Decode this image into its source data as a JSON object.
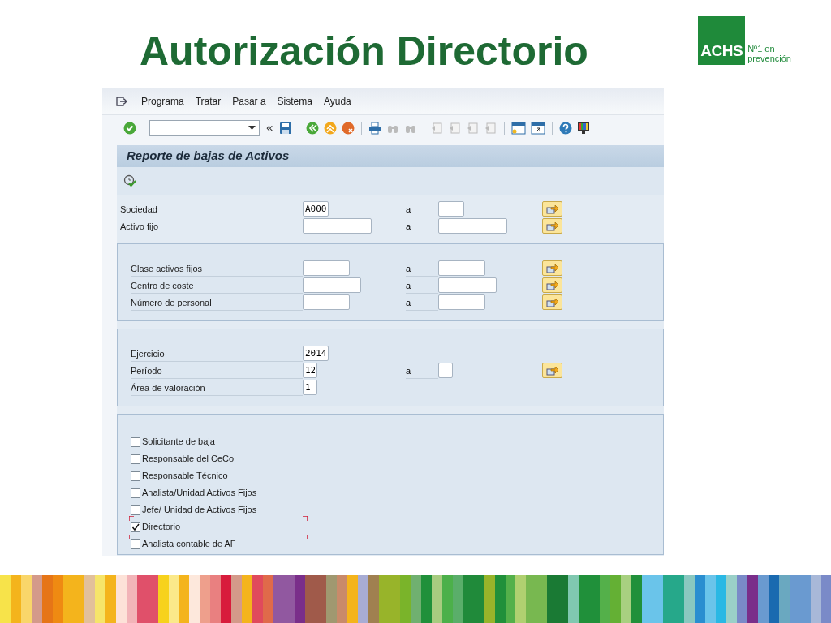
{
  "slide_title": "Autorización Directorio",
  "logo": {
    "mark": "ACHS",
    "tagline_lines": [
      "Nº1 en",
      "prevención"
    ]
  },
  "menu": [
    "Programa",
    "Tratar",
    "Pasar a",
    "Sistema",
    "Ayuda"
  ],
  "toolbar": {
    "collapse": "«"
  },
  "screen_title": "Reporte de bajas de Activos",
  "groups": [
    {
      "framed": false,
      "rows": [
        {
          "label": "Sociedad",
          "from": "A000",
          "to_label": "a"
        },
        {
          "label": "Activo fijo",
          "to_label": "a"
        }
      ]
    },
    {
      "framed": true,
      "rows": [
        {
          "label": "Clase activos fijos",
          "to_label": "a"
        },
        {
          "label": "Centro de coste",
          "to_label": "a"
        },
        {
          "label": "Número de personal",
          "to_label": "a"
        }
      ]
    },
    {
      "framed": true,
      "rows": [
        {
          "label": "Ejercicio",
          "from": "2014"
        },
        {
          "label": "Período",
          "from": "12",
          "to_label": "a"
        },
        {
          "label": "Área de valoración",
          "from": "1"
        }
      ]
    }
  ],
  "checkboxes": [
    {
      "label": "Solicitante de baja",
      "checked": false,
      "focused": false
    },
    {
      "label": "Responsable del CeCo",
      "checked": false,
      "focused": false
    },
    {
      "label": "Responsable Técnico",
      "checked": false,
      "focused": false
    },
    {
      "label": "Analista/Unidad Activos Fijos",
      "checked": false,
      "focused": false
    },
    {
      "label": "Jefe/ Unidad de Activos Fijos",
      "checked": false,
      "focused": false
    },
    {
      "label": "Directorio",
      "checked": true,
      "focused": true
    },
    {
      "label": "Analista contable de AF",
      "checked": false,
      "focused": false
    }
  ]
}
